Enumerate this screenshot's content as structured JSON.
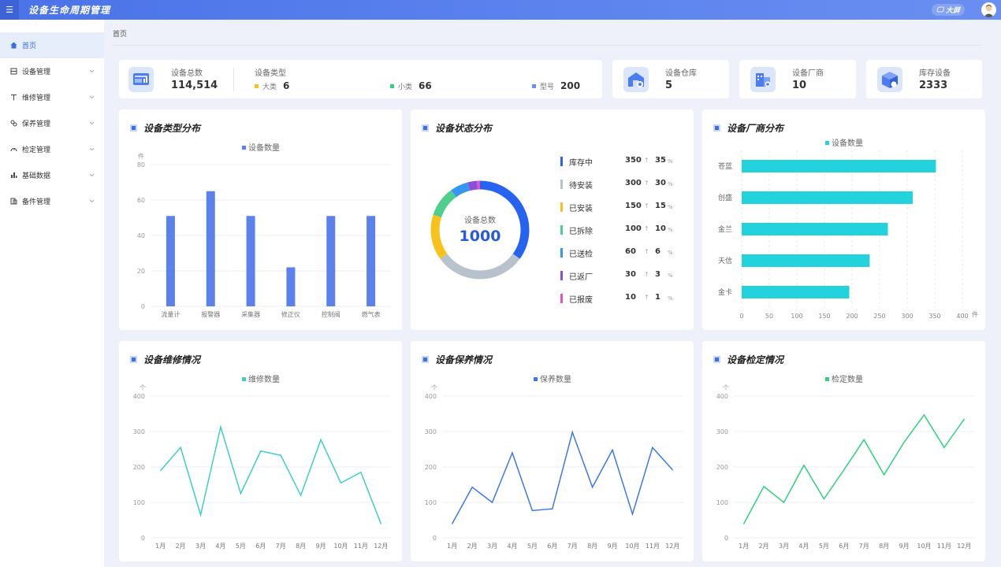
{
  "app": {
    "title": "设备生命周期管理",
    "bigscreen_label": "大屏"
  },
  "sidebar": {
    "items": [
      {
        "label": "首页",
        "icon": "home-icon",
        "active": true
      },
      {
        "label": "设备管理",
        "icon": "device-icon"
      },
      {
        "label": "维修管理",
        "icon": "wrench-icon"
      },
      {
        "label": "保养管理",
        "icon": "maintenance-icon"
      },
      {
        "label": "检定管理",
        "icon": "gauge-icon"
      },
      {
        "label": "基础数据",
        "icon": "chart-icon"
      },
      {
        "label": "备件管理",
        "icon": "parts-icon"
      }
    ]
  },
  "breadcrumb": "首页",
  "stats": {
    "total": {
      "label": "设备总数",
      "value": "114,514"
    },
    "types": {
      "label": "设备类型",
      "big_label": "大类",
      "big_value": "6",
      "small_label": "小类",
      "small_value": "66",
      "model_label": "型号",
      "model_value": "200"
    },
    "warehouse": {
      "label": "设备仓库",
      "value": "5"
    },
    "vendor": {
      "label": "设备厂商",
      "value": "10"
    },
    "stock": {
      "label": "库存设备",
      "value": "2333"
    }
  },
  "colors": {
    "accent": "#3b6fe4",
    "bar": "#5b82ec",
    "cyan": "#23d2dc",
    "teal": "#3ecfc3",
    "blue": "#3d78ea",
    "green": "#2ed17d"
  },
  "panels": {
    "type_dist": {
      "title": "设备类型分布"
    },
    "status_dist": {
      "title": "设备状态分布",
      "center_label": "设备总数",
      "center_value": "1000",
      "items": [
        {
          "name": "库存中",
          "count": "350",
          "pct": "35",
          "color": "#2663f0"
        },
        {
          "name": "待安装",
          "count": "300",
          "pct": "30",
          "color": "#b8c2cc"
        },
        {
          "name": "已安装",
          "count": "150",
          "pct": "15",
          "color": "#f9c21a"
        },
        {
          "name": "已拆除",
          "count": "100",
          "pct": "10",
          "color": "#4fd08a"
        },
        {
          "name": "已送检",
          "count": "60",
          "pct": "6",
          "color": "#3796f2"
        },
        {
          "name": "已返厂",
          "count": "30",
          "pct": "3",
          "color": "#8a4fd6"
        },
        {
          "name": "已报废",
          "count": "10",
          "pct": "1",
          "color": "#e650c0"
        }
      ],
      "arrow": "↑",
      "pct_sign": "%"
    },
    "vendor_dist": {
      "title": "设备厂商分布"
    },
    "repair": {
      "title": "设备维修情况"
    },
    "maint": {
      "title": "设备保养情况"
    },
    "calib": {
      "title": "设备检定情况"
    }
  },
  "chart_data": [
    {
      "id": "type",
      "type": "bar",
      "legend": "设备数量",
      "ylabel": "件",
      "ylim": [
        0,
        80
      ],
      "yticks": [
        0,
        20,
        40,
        60,
        80
      ],
      "categories": [
        "流量计",
        "报警器",
        "采集器",
        "修正仪",
        "控制阀",
        "燃气表"
      ],
      "values": [
        51,
        65,
        51,
        22,
        51,
        51
      ]
    },
    {
      "id": "vendor",
      "type": "bar",
      "orientation": "horizontal",
      "legend": "设备数量",
      "xlabel": "件",
      "xlim": [
        0,
        400
      ],
      "xticks": [
        0,
        50,
        100,
        150,
        200,
        250,
        300,
        350,
        400
      ],
      "categories": [
        "苍蓝",
        "创盛",
        "金兰",
        "天信",
        "金卡"
      ],
      "values": [
        352,
        310,
        265,
        232,
        195
      ]
    },
    {
      "id": "repair",
      "type": "line",
      "legend": "维修数量",
      "ylabel": "个",
      "ylim": [
        0,
        400
      ],
      "yticks": [
        0,
        100,
        200,
        300,
        400
      ],
      "categories": [
        "1月",
        "2月",
        "3月",
        "4月",
        "5月",
        "6月",
        "7月",
        "8月",
        "9月",
        "10月",
        "11月",
        "12月"
      ],
      "values": [
        190,
        255,
        65,
        313,
        125,
        245,
        233,
        120,
        277,
        155,
        185,
        40
      ]
    },
    {
      "id": "maint",
      "type": "line",
      "legend": "保养数量",
      "ylabel": "个",
      "ylim": [
        0,
        400
      ],
      "yticks": [
        0,
        100,
        200,
        300,
        400
      ],
      "categories": [
        "1月",
        "2月",
        "3月",
        "4月",
        "5月",
        "6月",
        "7月",
        "8月",
        "9月",
        "10月",
        "11月",
        "12月"
      ],
      "values": [
        40,
        143,
        100,
        240,
        77,
        82,
        298,
        143,
        248,
        67,
        255,
        192
      ]
    },
    {
      "id": "calib",
      "type": "line",
      "legend": "检定数量",
      "ylabel": "个",
      "ylim": [
        0,
        400
      ],
      "yticks": [
        0,
        100,
        200,
        300,
        400
      ],
      "categories": [
        "1月",
        "2月",
        "3月",
        "4月",
        "5月",
        "6月",
        "7月",
        "8月",
        "9月",
        "10月",
        "11月",
        "12月"
      ],
      "values": [
        40,
        145,
        100,
        205,
        110,
        192,
        277,
        178,
        270,
        347,
        255,
        335
      ]
    }
  ]
}
